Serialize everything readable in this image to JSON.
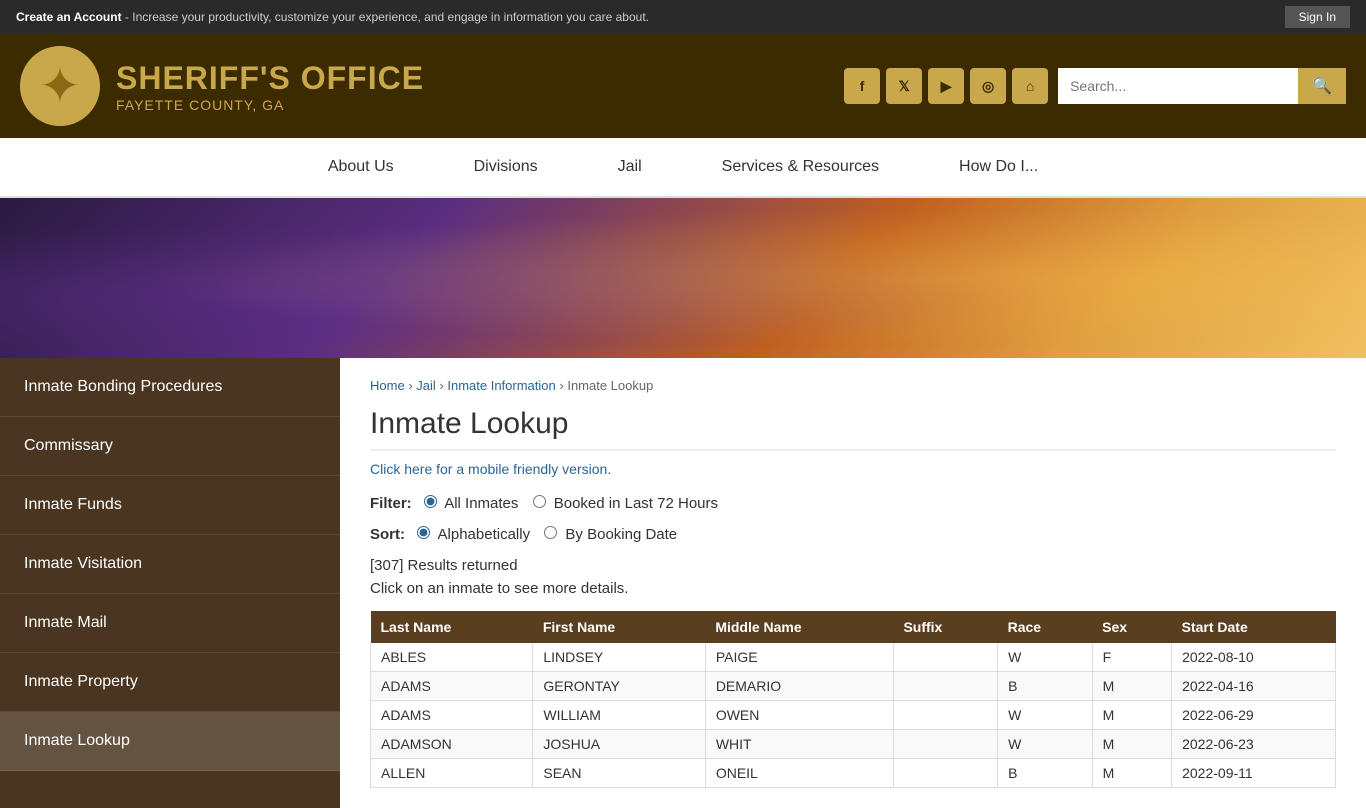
{
  "topbar": {
    "create_account_label": "Create an Account",
    "tagline": " - Increase your productivity, customize your experience, and engage in information you care about.",
    "sign_in_label": "Sign In"
  },
  "header": {
    "title": "SHERIFF'S OFFICE",
    "subtitle": "FAYETTE COUNTY, GA",
    "search_placeholder": "Search...",
    "social_links": [
      {
        "name": "facebook",
        "symbol": "f"
      },
      {
        "name": "twitter",
        "symbol": "t"
      },
      {
        "name": "youtube",
        "symbol": "▶"
      },
      {
        "name": "instagram",
        "symbol": "◎"
      },
      {
        "name": "home",
        "symbol": "⌂"
      }
    ]
  },
  "nav": {
    "items": [
      {
        "label": "About Us",
        "href": "#"
      },
      {
        "label": "Divisions",
        "href": "#"
      },
      {
        "label": "Jail",
        "href": "#"
      },
      {
        "label": "Services & Resources",
        "href": "#"
      },
      {
        "label": "How Do I...",
        "href": "#"
      }
    ]
  },
  "sidebar": {
    "items": [
      {
        "label": "Inmate Bonding Procedures",
        "href": "#",
        "active": false
      },
      {
        "label": "Commissary",
        "href": "#",
        "active": false
      },
      {
        "label": "Inmate Funds",
        "href": "#",
        "active": false
      },
      {
        "label": "Inmate Visitation",
        "href": "#",
        "active": false
      },
      {
        "label": "Inmate Mail",
        "href": "#",
        "active": false
      },
      {
        "label": "Inmate Property",
        "href": "#",
        "active": false
      },
      {
        "label": "Inmate Lookup",
        "href": "#",
        "active": true
      }
    ]
  },
  "breadcrumb": {
    "items": [
      {
        "label": "Home",
        "href": "#"
      },
      {
        "label": "Jail",
        "href": "#"
      },
      {
        "label": "Inmate Information",
        "href": "#"
      },
      {
        "label": "Inmate Lookup",
        "href": null
      }
    ]
  },
  "page": {
    "title": "Inmate Lookup",
    "mobile_link": "Click here for a mobile friendly version.",
    "filter_label": "Filter:",
    "filter_options": [
      {
        "label": "All Inmates",
        "value": "all",
        "checked": true
      },
      {
        "label": "Booked in Last 72 Hours",
        "value": "72hours",
        "checked": false
      }
    ],
    "sort_label": "Sort:",
    "sort_options": [
      {
        "label": "Alphabetically",
        "value": "alpha",
        "checked": true
      },
      {
        "label": "By Booking Date",
        "value": "date",
        "checked": false
      }
    ],
    "results_count": "[307] Results returned",
    "results_desc": "Click on an inmate to see more details.",
    "table_headers": [
      "Last Name",
      "First Name",
      "Middle Name",
      "Suffix",
      "Race",
      "Sex",
      "Start Date"
    ],
    "table_rows": [
      {
        "last": "ABLES",
        "first": "LINDSEY",
        "middle": "PAIGE",
        "suffix": "",
        "race": "W",
        "sex": "F",
        "start": "2022-08-10"
      },
      {
        "last": "ADAMS",
        "first": "GERONTAY",
        "middle": "DEMARIO",
        "suffix": "",
        "race": "B",
        "sex": "M",
        "start": "2022-04-16"
      },
      {
        "last": "ADAMS",
        "first": "WILLIAM",
        "middle": "OWEN",
        "suffix": "",
        "race": "W",
        "sex": "M",
        "start": "2022-06-29"
      },
      {
        "last": "ADAMSON",
        "first": "JOSHUA",
        "middle": "WHIT",
        "suffix": "",
        "race": "W",
        "sex": "M",
        "start": "2022-06-23"
      },
      {
        "last": "ALLEN",
        "first": "SEAN",
        "middle": "ONEIL",
        "suffix": "",
        "race": "B",
        "sex": "M",
        "start": "2022-09-11"
      }
    ]
  }
}
